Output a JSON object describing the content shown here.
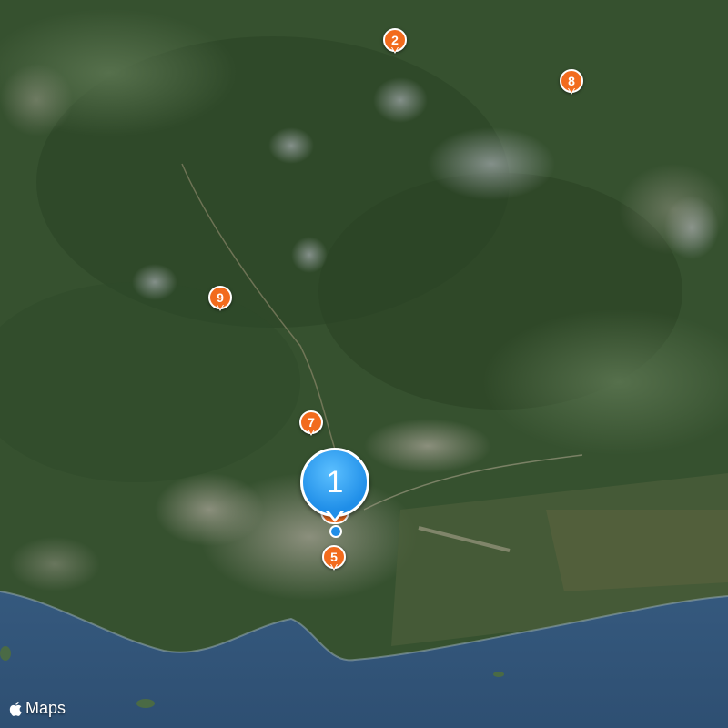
{
  "map": {
    "cluster": {
      "label": "1"
    },
    "pins": [
      {
        "label": "2"
      },
      {
        "label": "8"
      },
      {
        "label": "9"
      },
      {
        "label": "7"
      },
      {
        "label": "5"
      }
    ]
  },
  "attribution": {
    "brand_icon": "apple-logo-icon",
    "text": "Maps"
  },
  "colors": {
    "pin": "#f26b1d",
    "cluster": "#1f8ee8",
    "water": "#3a5d82",
    "land": "#3f5e36"
  }
}
